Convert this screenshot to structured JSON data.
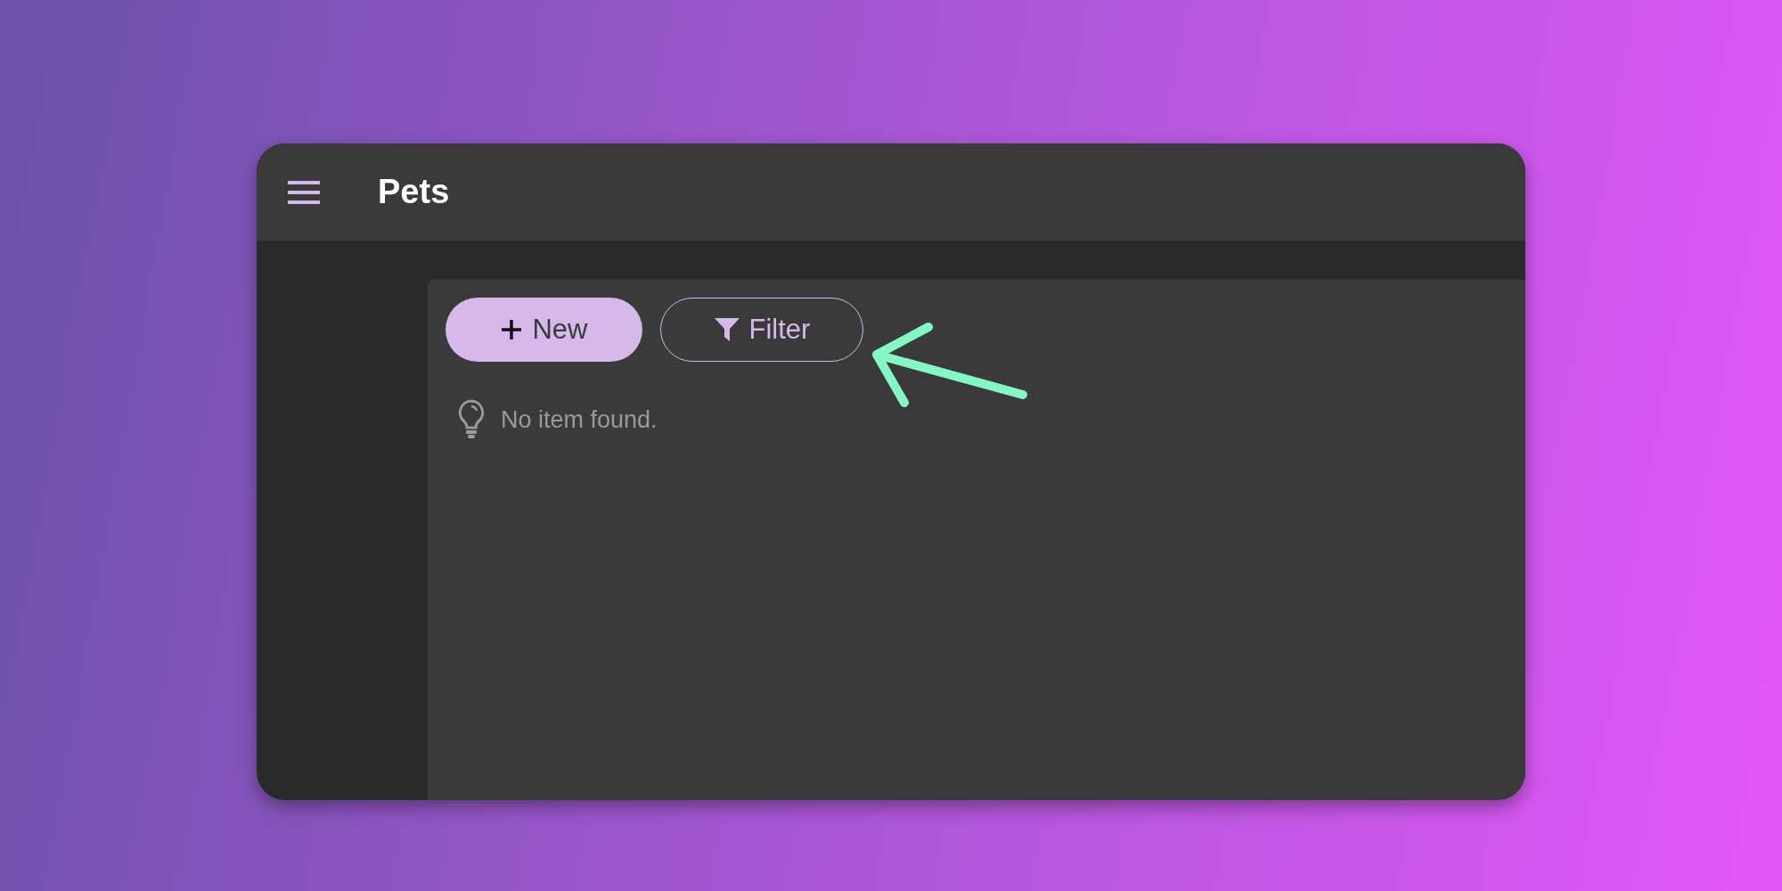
{
  "header": {
    "title": "Pets"
  },
  "toolbar": {
    "buttons": [
      {
        "label": "New",
        "kind": "primary"
      },
      {
        "label": "Filter",
        "kind": "outline"
      }
    ]
  },
  "empty_state": {
    "message": "No item found."
  }
}
